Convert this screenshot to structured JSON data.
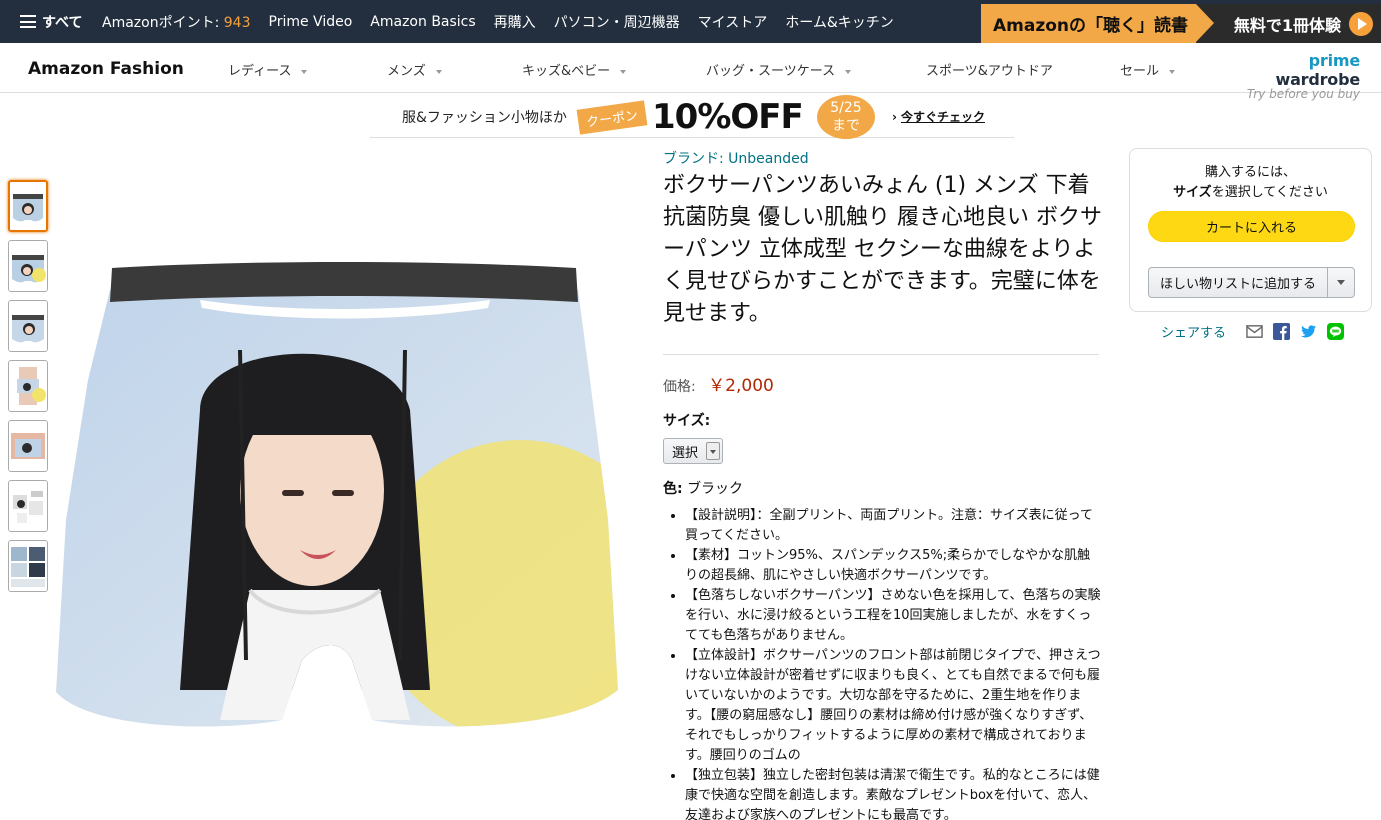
{
  "topnav": {
    "all_label": "すべて",
    "points_label": "Amazonポイント:",
    "points_value": "943",
    "links": [
      "Prime Video",
      "Amazon Basics",
      "再購入",
      "パソコン・周辺機器",
      "マイストア",
      "ホーム&キッチン"
    ],
    "promo_left": "Amazonの「聴く」読書",
    "promo_right": "無料で1冊体験"
  },
  "subnav": {
    "logo": "Amazon Fashion",
    "categories": [
      "レディース",
      "メンズ",
      "キッズ&ベビー",
      "バッグ・スーツケース",
      "スポーツ&アウトドア",
      "セール"
    ],
    "prime_wardrobe_a": "prime",
    "prime_wardrobe_b": "wardrobe",
    "prime_wardrobe_tag": "Try before you buy"
  },
  "banner": {
    "label": "服&ファッション小物ほか",
    "coupon": "クーポン",
    "off": "10%OFF",
    "date_line1": "5/25",
    "date_line2": "まで",
    "check": "今すぐチェック"
  },
  "product": {
    "brand": "ブランド: Unbeanded",
    "title": "ボクサーパンツあいみょん (1) メンズ 下着 抗菌防臭 優しい肌触り 履き心地良い ボクサーパンツ 立体成型 セクシーな曲線をよりよく見せびらかすことができます。完璧に体を見せます。",
    "price_label": "価格:",
    "price": "￥2,000",
    "size_label": "サイズ:",
    "size_select": "選択",
    "color_label": "色:",
    "color_value": "ブラック",
    "bullets": [
      "【設計説明】：全副プリント、両面プリント。注意：サイズ表に従って買ってください。",
      "【素材】コットン95%、スパンデックス5%;柔らかでしなやかな肌触りの超長綿、肌にやさしい快適ボクサーパンツです。",
      "【色落ちしないボクサーパンツ】さめない色を採用して、色落ちの実験を行い、水に浸け絞るという工程を10回実施しましたが、水をすくってても色落ちがありません。",
      "【立体設計】ボクサーパンツのフロント部は前閉じタイプで、押さえつけない立体設計が密着せずに収まりも良く、とても自然でまるで何も履いていないかのようです。大切な部を守るために、2重生地を作ります。【腰の窮屈感なし】腰回りの素材は締め付け感が強くなりすぎず、それでもしっかりフィットするように厚めの素材で構成されております。腰回りのゴムの",
      "【独立包装】独立した密封包装は清潔で衛生です。私的なところには健康で快適な空間を創造します。素敵なプレゼントboxを付いて、恋人、友達および家族へのプレゼントにも最高です。"
    ]
  },
  "buybox": {
    "msg_line1": "購入するには、",
    "msg_bold": "サイズ",
    "msg_line2": "を選択してください",
    "cart": "カートに入れる",
    "wishlist": "ほしい物リストに追加する"
  },
  "share": {
    "label": "シェアする"
  },
  "colors": {
    "nav": "#232f3e",
    "accent": "#f3a847",
    "price": "#b12704",
    "link": "#007185",
    "cart": "#ffd814"
  }
}
